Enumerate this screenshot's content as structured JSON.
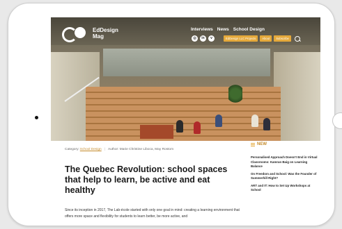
{
  "site": {
    "name": "EdDesign",
    "name_line2": "Mag"
  },
  "nav": {
    "items": [
      "Interviews",
      "News",
      "School Design"
    ]
  },
  "social": [
    "instagram-icon",
    "linkedin-icon",
    "vimeo-icon"
  ],
  "header_buttons": [
    "EdDesign LLC Projects",
    "About",
    "Subscribe"
  ],
  "article": {
    "category_label": "Category:",
    "category": "School Design",
    "separator": "|",
    "author": "Author: Marie Christine Liboca, May Rostom",
    "title": "The Quebec Revolution: school spaces that help to learn, be active and eat healthy",
    "lead": "Since its inception in 2017, The Lab-école started with only one goal in mind: creating a learning environment that offers more space and flexibility for students to learn better, be more active, and"
  },
  "sidebar": {
    "heading": "NEW",
    "posts": [
      "Personalised Approach Doesn't End in Virtual Classrooms: Kamran Baig on Learning Balance",
      "On Freedom and School: Was the Founder of Summerhill Right?",
      "ART and IT: How to Set Up Workshops at School"
    ]
  },
  "colors": {
    "accent": "#e5a93b",
    "accent_text": "#c48a2a"
  }
}
